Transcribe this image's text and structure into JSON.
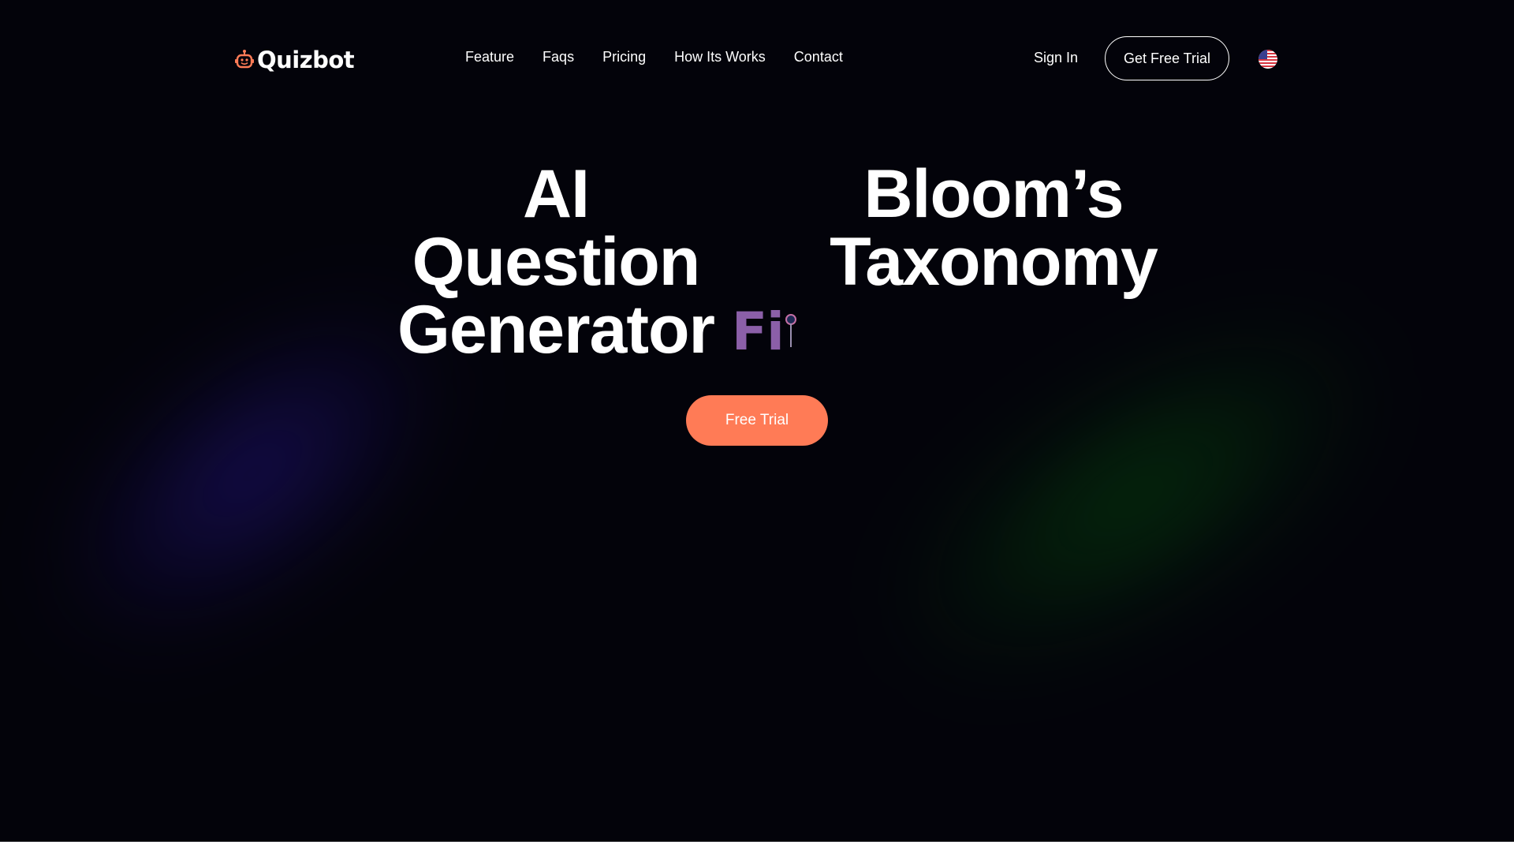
{
  "brand": {
    "name": "Quizbot",
    "logo_icon": "robot-head-icon",
    "accent_color": "#ff7b56"
  },
  "nav": {
    "items": [
      {
        "label": "Feature"
      },
      {
        "label": "Faqs"
      },
      {
        "label": "Pricing"
      },
      {
        "label": "How Its Works"
      },
      {
        "label": "Contact"
      }
    ]
  },
  "header_actions": {
    "sign_in_label": "Sign In",
    "get_trial_label": "Get Free Trial",
    "language_icon": "us-flag-icon"
  },
  "hero": {
    "title_left": [
      "AI Question",
      "Generator"
    ],
    "title_right": [
      "Bloom’s",
      "Taxonomy"
    ],
    "typing_text": "Fi",
    "typing_color": "#8b5fa8",
    "cta_label": "Free Trial"
  },
  "background": {
    "base": "#03030a",
    "glow_left": "#1e126e",
    "glow_right": "#063c0e"
  }
}
